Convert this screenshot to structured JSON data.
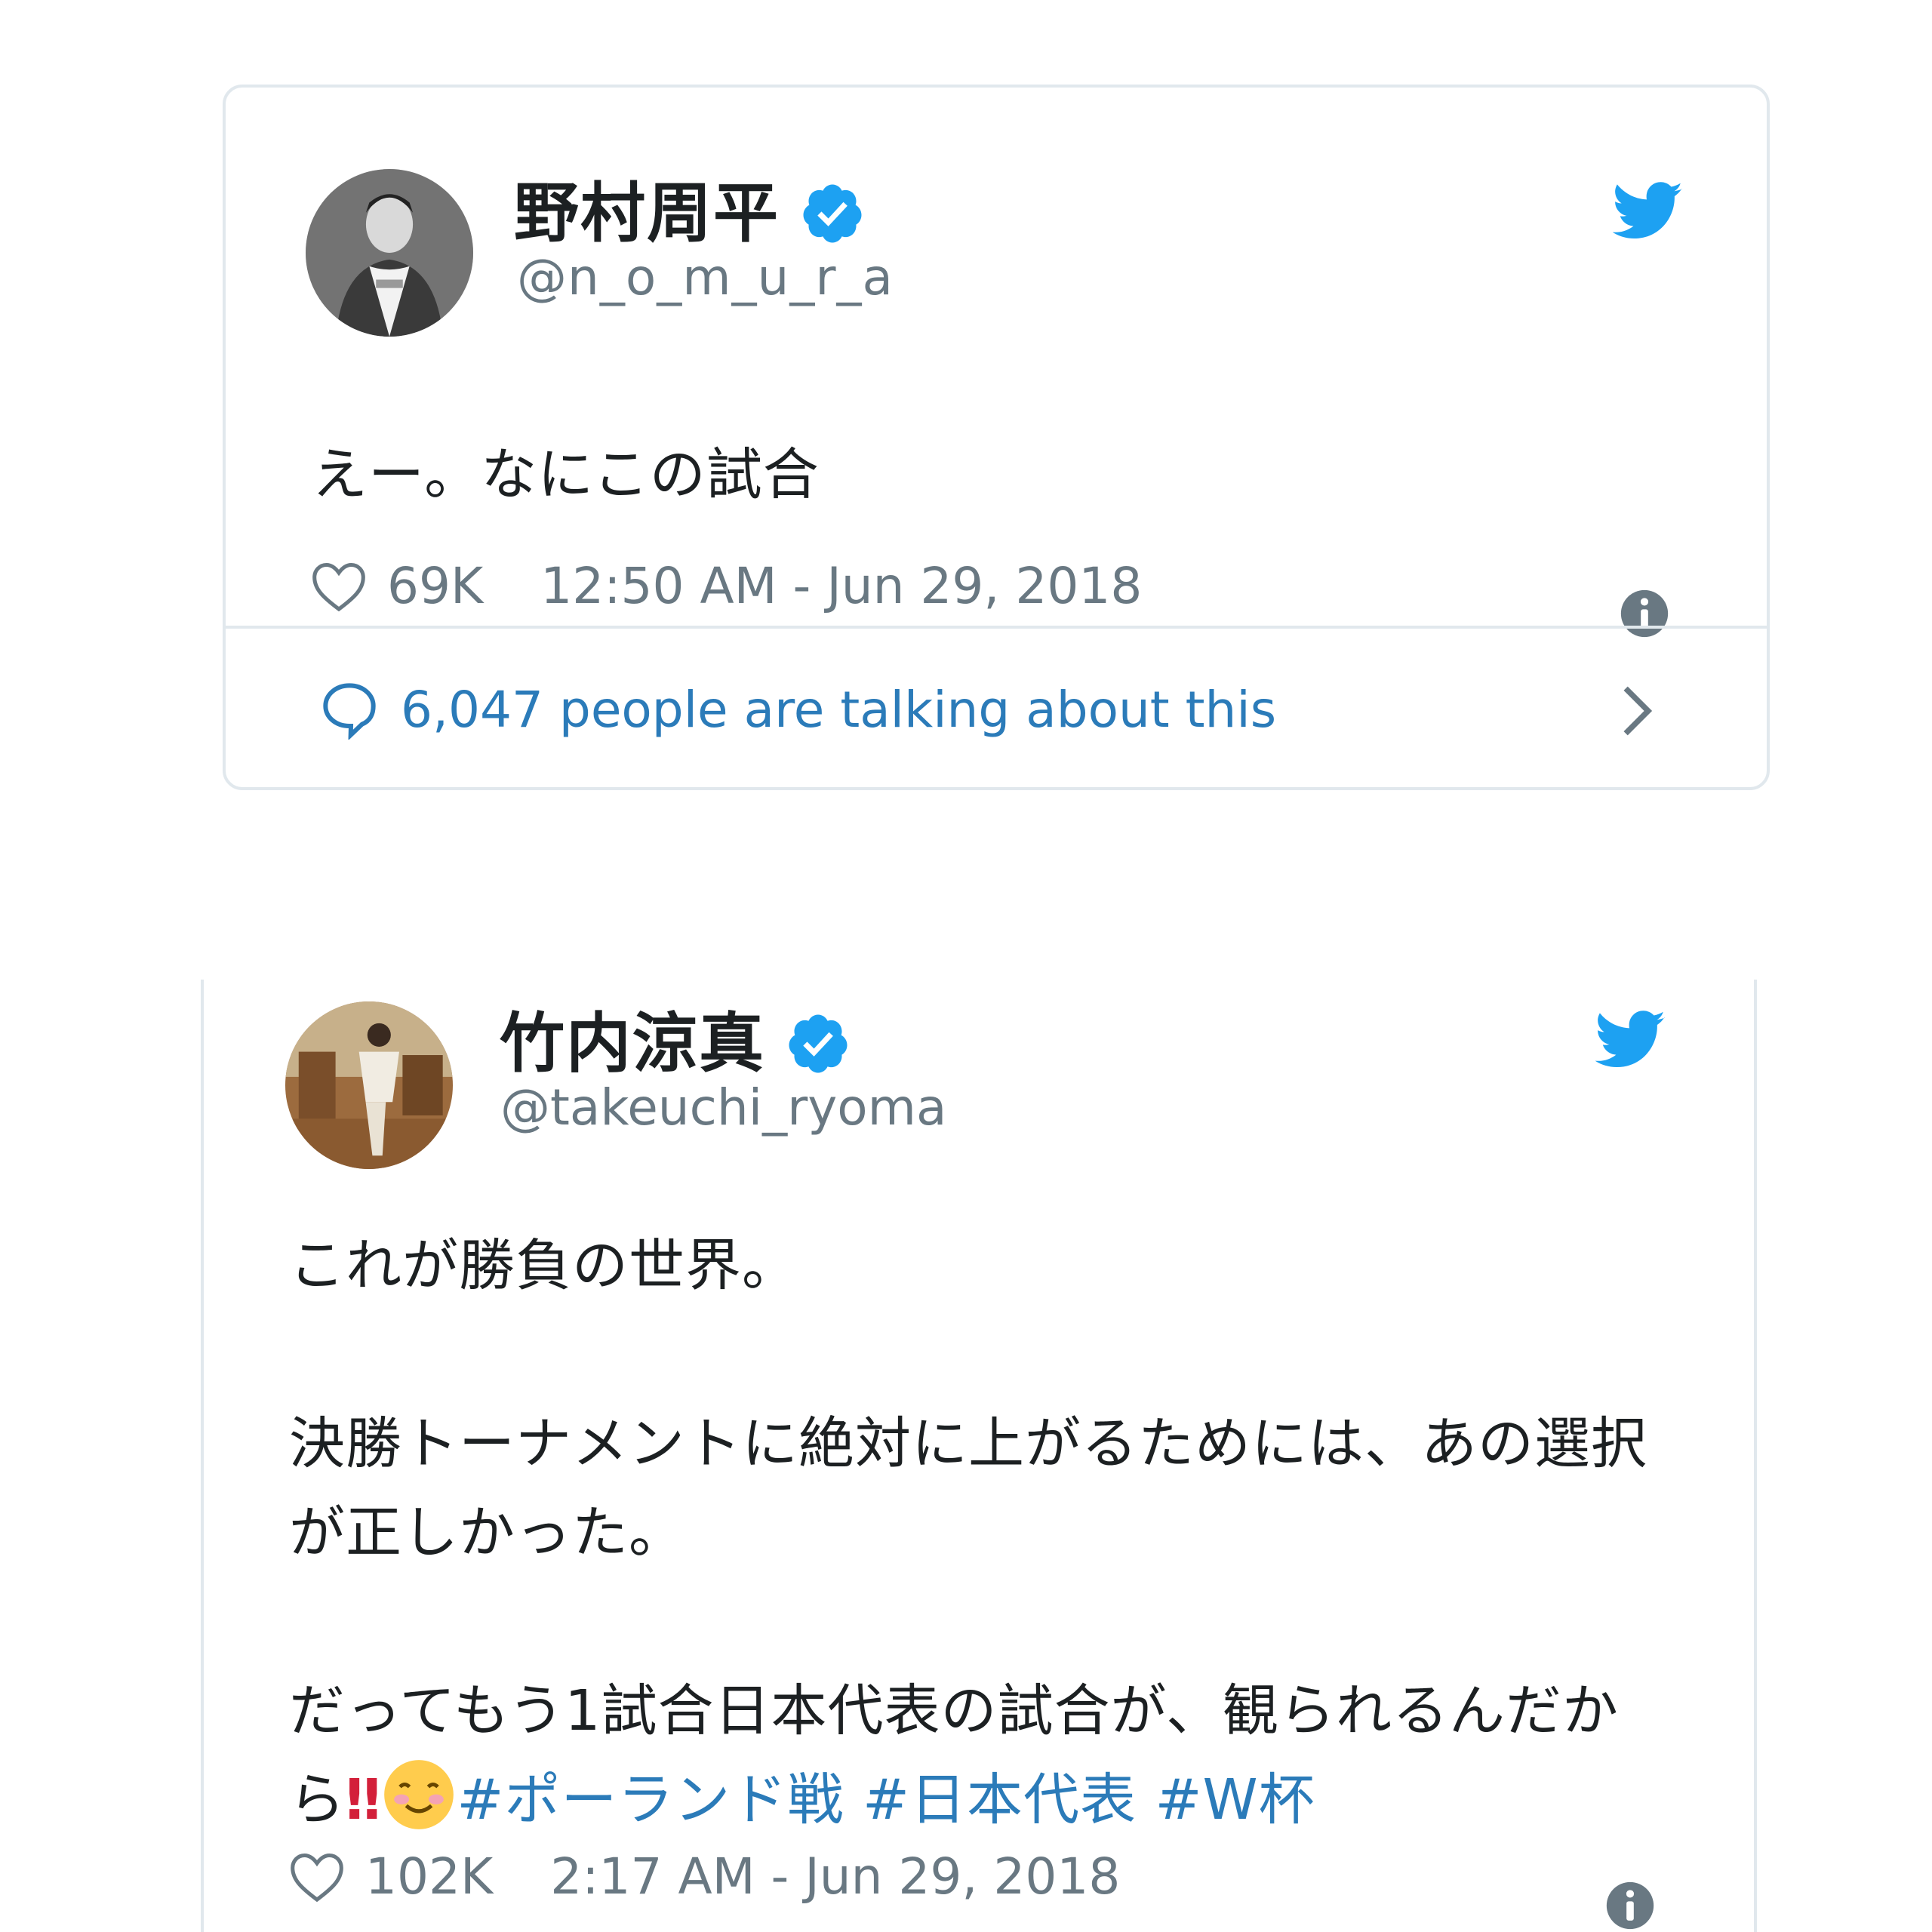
{
  "tweets": [
    {
      "name": "野村周平",
      "handle": "@n_o_m_u_r_a",
      "text": "えー。なにこの試合",
      "likes": "69K",
      "timestamp": "12:50 AM - Jun 29, 2018",
      "talking": "6,047 people are talking about this"
    },
    {
      "name": "竹内涼真",
      "handle": "@takeuchi_ryoma",
      "text_p1": "これが勝負の世界。",
      "text_p2": "決勝トーナメントに絶対に上がるためには、あの選択が正しかった。",
      "text_p3": "だってもう1試合日本代表の試合が、観られるんだから",
      "text_exclaim": "‼",
      "hashtags": [
        "#ポーランド戦",
        "#日本代表",
        "#W杯"
      ],
      "likes": "102K",
      "timestamp": "2:17 AM - Jun 29, 2018"
    }
  ],
  "colors": {
    "twitter_blue": "#1da1f2",
    "link_blue": "#2b7bb9",
    "meta_gray": "#697882",
    "border": "#e1e8ed"
  },
  "icons": [
    "verified-badge-icon",
    "twitter-bird-icon",
    "heart-icon",
    "info-icon",
    "speech-bubble-icon",
    "chevron-right-icon",
    "smiling-blush-emoji-icon",
    "double-exclamation-emoji-icon"
  ]
}
